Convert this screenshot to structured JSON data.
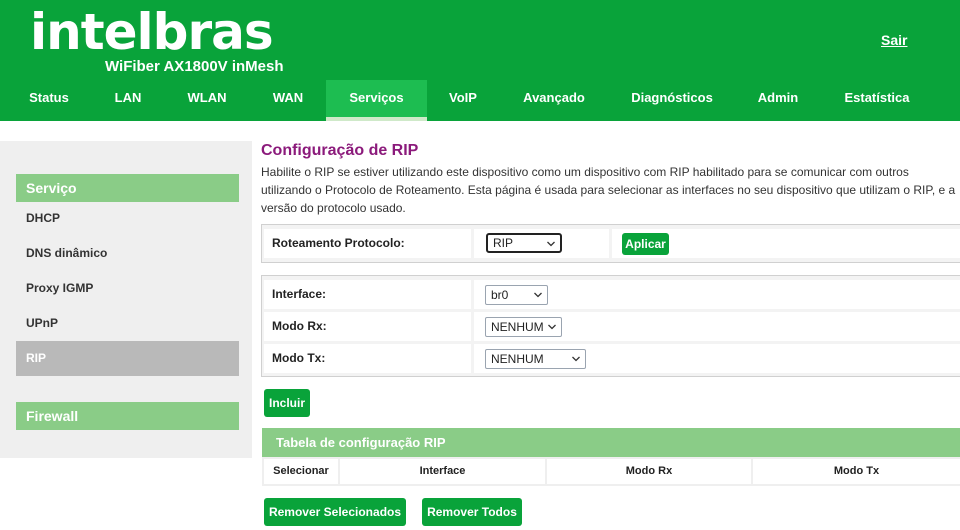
{
  "brand": {
    "logo": "intelbras",
    "model": "WiFiber AX1800V inMesh",
    "logout_label": "Sair"
  },
  "nav": {
    "items": [
      {
        "label": "Status"
      },
      {
        "label": "LAN"
      },
      {
        "label": "WLAN"
      },
      {
        "label": "WAN"
      },
      {
        "label": "Serviços",
        "active": true
      },
      {
        "label": "VoIP"
      },
      {
        "label": "Avançado"
      },
      {
        "label": "Diagnósticos"
      },
      {
        "label": "Admin"
      },
      {
        "label": "Estatística"
      }
    ]
  },
  "sidebar": {
    "section1": "Serviço",
    "items": [
      {
        "label": "DHCP"
      },
      {
        "label": "DNS dinâmico"
      },
      {
        "label": "Proxy IGMP"
      },
      {
        "label": "UPnP"
      },
      {
        "label": "RIP",
        "active": true
      }
    ],
    "section2": "Firewall"
  },
  "page": {
    "title": "Configuração de RIP",
    "description": "Habilite o RIP se estiver utilizando este dispositivo como um dispositivo com RIP habilitado para se comunicar com outros utilizando o Protocolo de Roteamento. Esta página é usada para selecionar as interfaces no seu dispositivo que utilizam o RIP, e a versão do protocolo usado."
  },
  "protocol": {
    "label": "Roteamento Protocolo:",
    "value": "RIP",
    "apply_label": "Aplicar"
  },
  "form": {
    "interface_label": "Interface:",
    "interface_value": "br0",
    "rx_label": "Modo Rx:",
    "rx_value": "NENHUM",
    "tx_label": "Modo Tx:",
    "tx_value": "NENHUM",
    "add_label": "Incluir"
  },
  "table": {
    "title": "Tabela de configuração RIP",
    "columns": [
      "Selecionar",
      "Interface",
      "Modo Rx",
      "Modo Tx"
    ]
  },
  "actions": {
    "remove_selected": "Remover Selecionados",
    "remove_all": "Remover Todos"
  },
  "colors": {
    "brand_green": "#09a33a",
    "light_green": "#8acc87",
    "title_purple": "#8b1a7b"
  }
}
